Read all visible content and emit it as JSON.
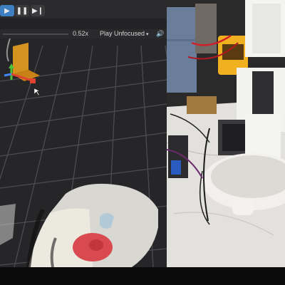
{
  "toolbar": {
    "play_label": "play-icon",
    "pause_label": "pause-icon",
    "step_label": "step-icon"
  },
  "timebar": {
    "speed": "0.52x",
    "play_mode": "Play Unfocused",
    "caret": "▾",
    "audio_icon": "speaker-icon"
  },
  "colors": {
    "play_active": "#3d7fc1",
    "grid_line": "#5a5a5e",
    "gizmo_x": "#e0432f",
    "gizmo_y": "#4cc33a",
    "gizmo_z": "#3f86f0",
    "gizmo_box": "#e8a01d",
    "gripper_pad": "#d84a4f"
  }
}
